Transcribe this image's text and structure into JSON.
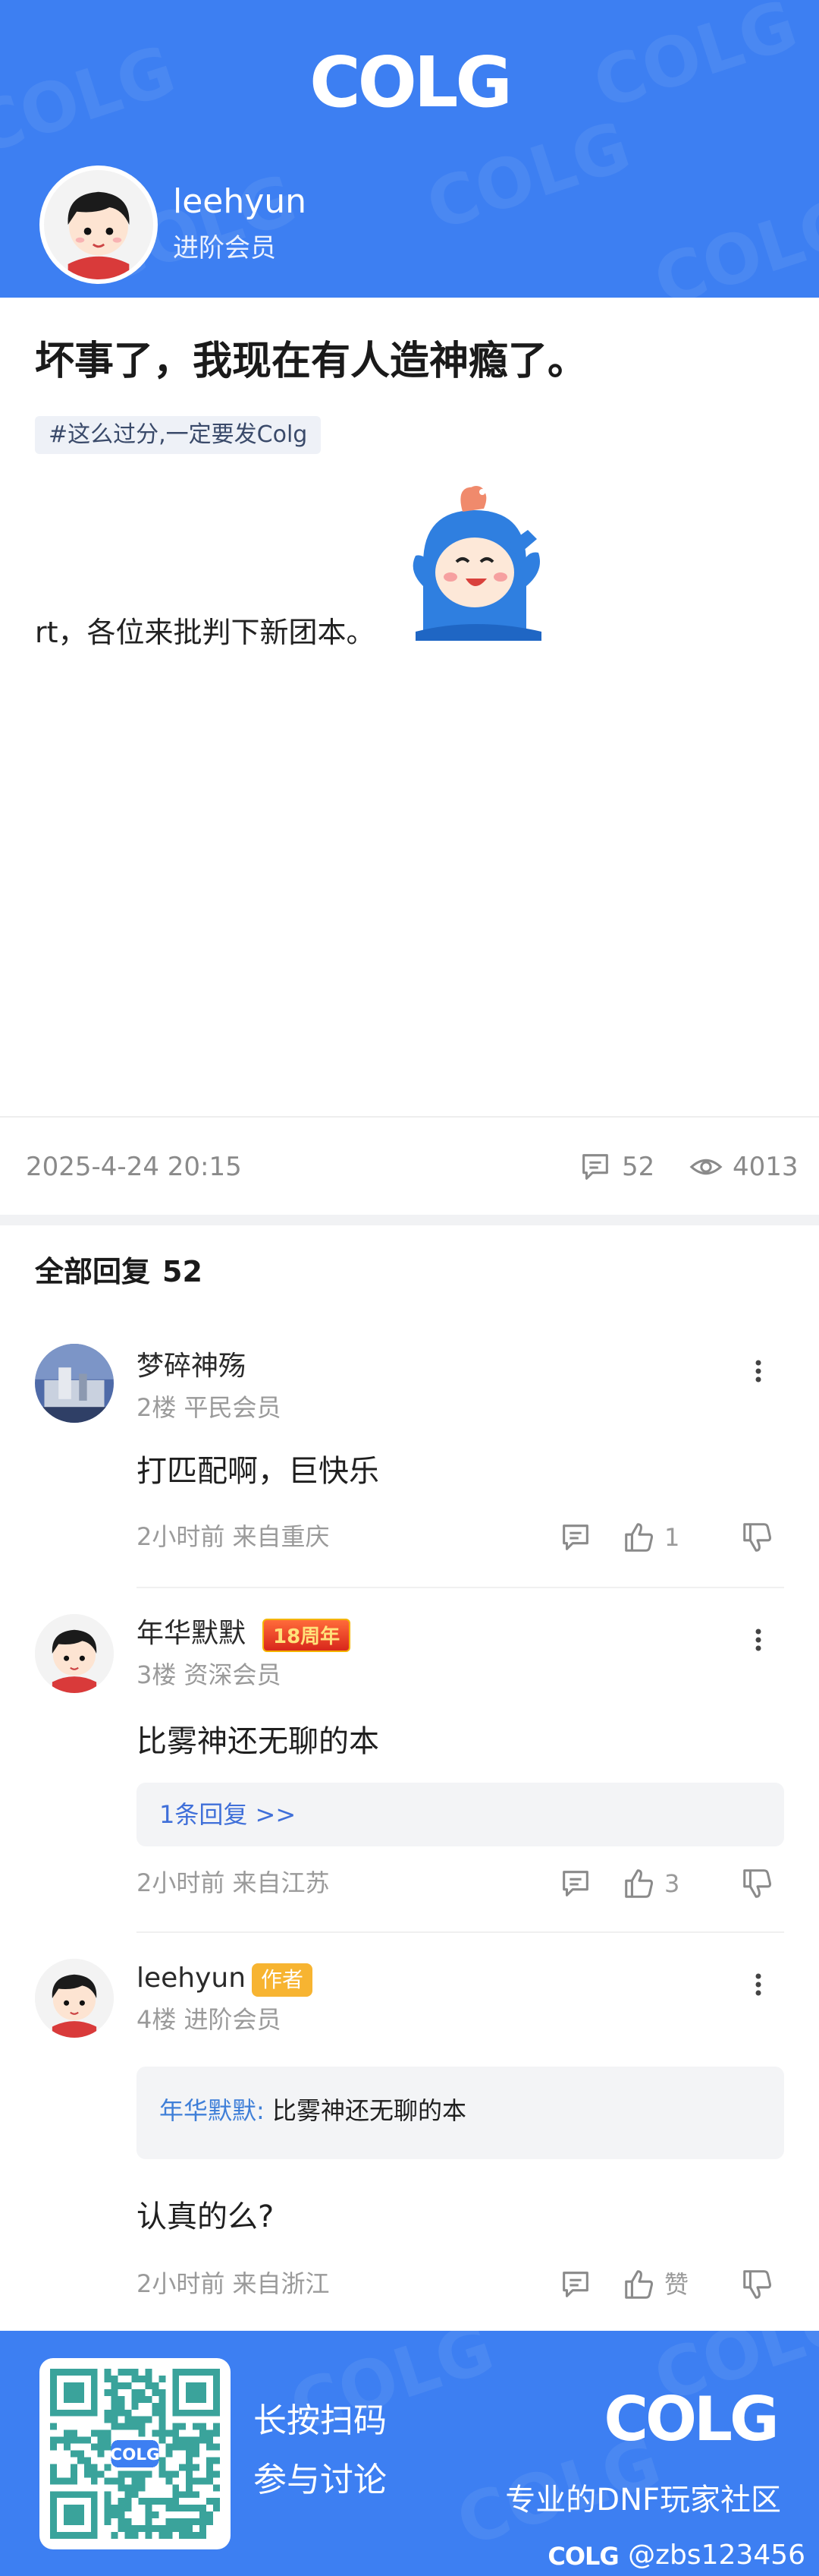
{
  "theme": {
    "brand_blue": "#3d7ff2",
    "link_blue": "#3f6fd9",
    "muted": "#9a9a9a",
    "author_badge": "#f7b431"
  },
  "header": {
    "logo_text": "COLG",
    "author_name": "leehyun",
    "author_level": "进阶会员"
  },
  "post": {
    "title": "坏事了，我现在有人造神瘾了。",
    "tag": "#这么过分,一定要发Colg",
    "body": "rt，各位来批判下新团本。",
    "date": "2025-4-24 20:15",
    "comment_count": "52",
    "view_count": "4013"
  },
  "replies_header": {
    "label": "全部回复",
    "count": "52"
  },
  "replies": [
    {
      "name": "梦碎神殇",
      "floor": "2楼",
      "level": "平民会员",
      "text": "打匹配啊，巨快乐",
      "time": "2小时前",
      "location": "来自重庆",
      "likes": "1"
    },
    {
      "name": "年华默默",
      "badge": "18周年",
      "floor": "3楼",
      "level": "资深会员",
      "text": "比雾神还无聊的本",
      "sub_replies": "1条回复 >>",
      "time": "2小时前",
      "location": "来自江苏",
      "likes": "3"
    },
    {
      "name": "leehyun",
      "badge": "作者",
      "floor": "4楼",
      "level": "进阶会员",
      "quote_name": "年华默默:",
      "quote_text": "比雾神还无聊的本",
      "text": "认真的么?",
      "time": "2小时前",
      "location": "来自浙江",
      "likes": "赞"
    }
  ],
  "footer": {
    "cta_line1": "长按扫码",
    "cta_line2": "参与讨论",
    "logo_text": "COLG",
    "slogan": "专业的DNF玩家社区",
    "watermark_user": "@zbs123456"
  }
}
